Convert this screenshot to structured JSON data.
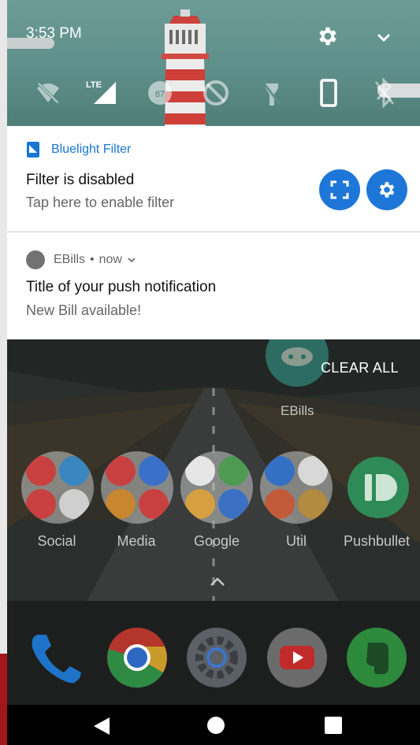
{
  "status": {
    "time": "3:53 PM",
    "network_label": "LTE",
    "battery_level": "87"
  },
  "quick_settings_icons": [
    "wifi-off-icon",
    "lte-signal-icon",
    "data-saver-icon",
    "location-off-icon",
    "flashlight-off-icon",
    "rotation-icon",
    "bluetooth-off-icon"
  ],
  "notifications": [
    {
      "app": "Bluelight Filter",
      "title": "Filter is disabled",
      "text": "Tap here to enable filter",
      "accent": "#1976d2"
    },
    {
      "app": "EBills",
      "time": "now",
      "title": "Title of your push notification",
      "text": "New Bill available!"
    }
  ],
  "launcher": {
    "clear_all": "CLEAR ALL",
    "ebills_label": "EBills",
    "folders": [
      "Social",
      "Media",
      "Google",
      "Util",
      "Pushbullet"
    ],
    "dock_apps": [
      "phone-icon",
      "chrome-icon",
      "settings-icon",
      "youtube-icon",
      "evernote-icon"
    ]
  },
  "colors": {
    "quick_settings_bg": "#5f8f8a",
    "notification_accent": "#1e76d8",
    "nav_bar": "#000000"
  }
}
